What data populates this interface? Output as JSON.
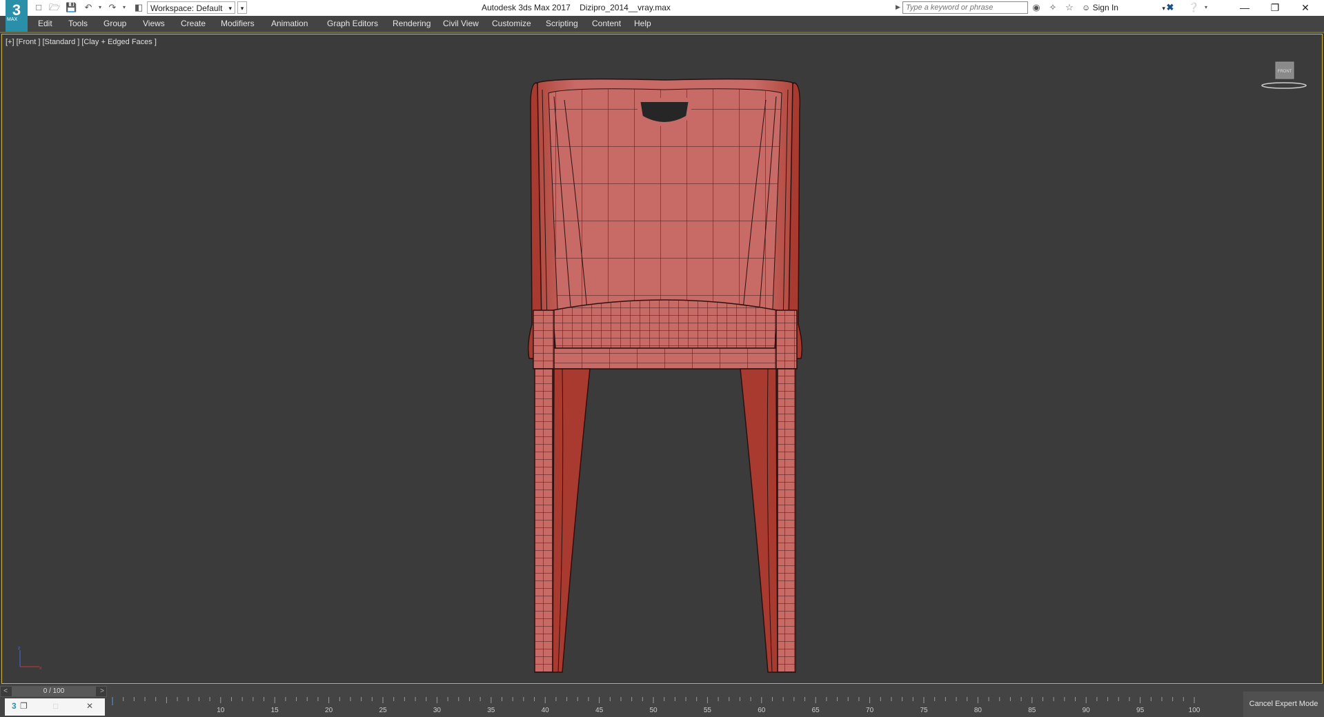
{
  "app": {
    "logo_text": "3",
    "logo_subtext": "MAX",
    "title": "Autodesk 3ds Max 2017",
    "filename": "Dizipro_2014__vray.max"
  },
  "quick_access": {
    "workspace_label": "Workspace: Default"
  },
  "search": {
    "placeholder": "Type a keyword or phrase"
  },
  "account": {
    "sign_in_label": "Sign In"
  },
  "menu": {
    "items": [
      "Edit",
      "Tools",
      "Group",
      "Views",
      "Create",
      "Modifiers",
      "Animation",
      "Graph Editors",
      "Rendering",
      "Civil View",
      "Customize",
      "Scripting",
      "Content",
      "Help"
    ]
  },
  "viewport": {
    "label": "[+] [Front ] [Standard ] [Clay + Edged Faces ]",
    "viewcube_face": "FRONT",
    "border_color": "#d4b24a",
    "background_color": "#3b3b3b",
    "model_color": "#c86a66",
    "edge_color": "#3a1a18"
  },
  "timeline": {
    "frame_display": "0 / 100",
    "prev_arrow": "<",
    "next_arrow": ">",
    "current_frame": 0,
    "total_frames": 100,
    "ruler_labels": [
      "10",
      "15",
      "20",
      "25",
      "30",
      "35",
      "40",
      "45",
      "50",
      "55",
      "60",
      "65",
      "70",
      "75",
      "80",
      "85",
      "90",
      "95",
      "100"
    ]
  },
  "status": {
    "cancel_expert_label": "Cancel Expert Mode"
  },
  "icons": {
    "new": "new-file-icon",
    "open": "open-file-icon",
    "save": "save-icon",
    "undo": "undo-icon",
    "redo": "redo-icon",
    "project": "project-folder-icon",
    "binoculars": "binoculars-icon",
    "star": "favorites-star-icon",
    "user": "user-icon",
    "exchange": "autodesk-exchange-icon",
    "help": "help-icon"
  }
}
